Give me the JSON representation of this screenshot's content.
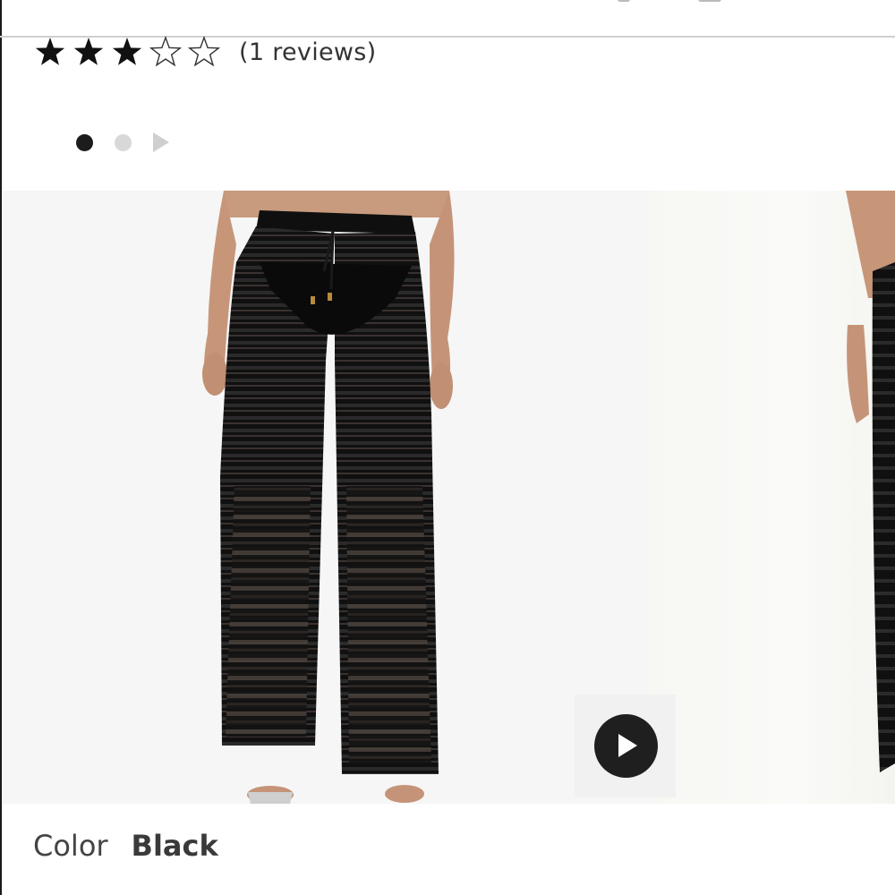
{
  "rating": {
    "value": 3,
    "max": 5,
    "review_count_text": "(1 reviews)"
  },
  "carousel": {
    "slide_count": 2,
    "active_index": 0
  },
  "gallery": {
    "video_icon": "play-icon"
  },
  "color": {
    "label": "Color",
    "value": "Black"
  },
  "colors": {
    "star": "#111111",
    "dot_active": "#1c1c1c",
    "dot_inactive": "#d8d8d8",
    "garment": "#141414"
  }
}
